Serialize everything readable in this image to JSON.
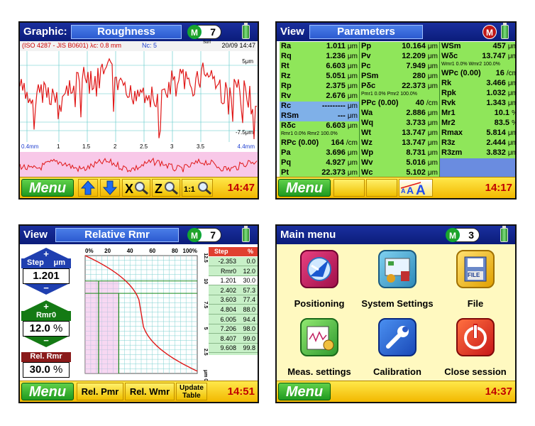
{
  "panel_graphic": {
    "label": "Graphic:",
    "title": "Roughness",
    "m_badge": "M",
    "count": "7",
    "info_left": "(ISO 4287 - JIS B0601)  λc: 0.8 mm",
    "info_nc": "Nc: 5",
    "surf": "Surf",
    "date": "20/09 14:47",
    "y_top": "5μm",
    "y_bottom": "-7.5μm",
    "x_left": "0.4mm",
    "x_ticks": [
      "1",
      "1.5",
      "2",
      "2.5",
      "3",
      "3.5"
    ],
    "x_right": "4.4mm",
    "menu": "Menu",
    "buttons": [
      "X",
      "Z",
      "1:1"
    ],
    "time": "14:47"
  },
  "panel_params": {
    "label": "View",
    "title": "Parameters",
    "m_badge": "M",
    "col1": [
      {
        "n": "Ra",
        "v": "1.011",
        "u": "μm"
      },
      {
        "n": "Rq",
        "v": "1.236",
        "u": "μm"
      },
      {
        "n": "Rt",
        "v": "6.603",
        "u": "μm"
      },
      {
        "n": "Rz",
        "v": "5.051",
        "u": "μm"
      },
      {
        "n": "Rp",
        "v": "2.375",
        "u": "μm"
      },
      {
        "n": "Rv",
        "v": "2.676",
        "u": "μm"
      },
      {
        "n": "Rc",
        "v": "---------",
        "u": "μm"
      },
      {
        "n": "RSm",
        "v": "---",
        "u": "μm"
      },
      {
        "n": "Rδc",
        "v": "6.603",
        "u": "μm"
      },
      {
        "n": "RPc (0.00)",
        "v": "164",
        "u": "/cm"
      },
      {
        "n": "Pa",
        "v": "3.696",
        "u": "μm"
      },
      {
        "n": "Pq",
        "v": "4.927",
        "u": "μm"
      },
      {
        "n": "Pt",
        "v": "22.373",
        "u": "μm"
      }
    ],
    "col1_sub": "Rmr1 0.0%  Rmr2 100.0%",
    "col2": [
      {
        "n": "Pp",
        "v": "10.164",
        "u": "μm"
      },
      {
        "n": "Pv",
        "v": "12.209",
        "u": "μm"
      },
      {
        "n": "Pc",
        "v": "7.949",
        "u": "μm"
      },
      {
        "n": "PSm",
        "v": "280",
        "u": "μm"
      },
      {
        "n": "Pδc",
        "v": "22.373",
        "u": "μm"
      },
      {
        "n": "PPc (0.00)",
        "v": "40",
        "u": "/cm"
      },
      {
        "n": "Wa",
        "v": "2.886",
        "u": "μm"
      },
      {
        "n": "Wq",
        "v": "3.733",
        "u": "μm"
      },
      {
        "n": "Wt",
        "v": "13.747",
        "u": "μm"
      },
      {
        "n": "Wz",
        "v": "13.747",
        "u": "μm"
      },
      {
        "n": "Wp",
        "v": "8.731",
        "u": "μm"
      },
      {
        "n": "Wv",
        "v": "5.016",
        "u": "μm"
      },
      {
        "n": "Wc",
        "v": "5.102",
        "u": "μm"
      }
    ],
    "col2_sub": "Pmr1 0.0%  Pmr2 100.0%",
    "col3": [
      {
        "n": "WSm",
        "v": "457",
        "u": "μm"
      },
      {
        "n": "Wδc",
        "v": "13.747",
        "u": "μm"
      },
      {
        "n": "WPc (0.00)",
        "v": "16",
        "u": "/cm"
      },
      {
        "n": "Rk",
        "v": "3.466",
        "u": "μm"
      },
      {
        "n": "Rpk",
        "v": "1.032",
        "u": "μm"
      },
      {
        "n": "Rvk",
        "v": "1.343",
        "u": "μm"
      },
      {
        "n": "Mr1",
        "v": "10.1",
        "u": "%"
      },
      {
        "n": "Mr2",
        "v": "83.5",
        "u": "%"
      },
      {
        "n": "Rmax",
        "v": "5.814",
        "u": "μm"
      },
      {
        "n": "R3z",
        "v": "2.444",
        "u": "μm"
      },
      {
        "n": "R3zm",
        "v": "3.832",
        "u": "μm"
      }
    ],
    "col3_sub": "Wmr1 0.0%  Wmr2 100.0%",
    "menu": "Menu",
    "time": "14:17"
  },
  "panel_rmr": {
    "label": "View",
    "title": "Relative Rmr",
    "m_badge": "M",
    "count": "7",
    "step_label": "Step",
    "step_unit": "μm",
    "step_value": "1.201",
    "rmr0_label": "Rmr0",
    "rmr0_value": "12.0",
    "rmr0_unit": "%",
    "rel_label": "Rel. Rmr",
    "rel_value": "30.0",
    "rel_unit": "%",
    "x_ticks": [
      "0%",
      "20",
      "40",
      "60",
      "80",
      "100%"
    ],
    "y_ticks": [
      "12.5",
      "10",
      "7.5",
      "5",
      "2.5",
      "μm 0"
    ],
    "table_headers": [
      "Step",
      "%"
    ],
    "table_rows": [
      [
        "-2.353",
        "0.0"
      ],
      [
        "Rmr0",
        "12.0"
      ],
      [
        "1.201",
        "30.0"
      ],
      [
        "2.402",
        "57.3"
      ],
      [
        "3.603",
        "77.4"
      ],
      [
        "4.804",
        "88.0"
      ],
      [
        "6.005",
        "94.4"
      ],
      [
        "7.206",
        "98.0"
      ],
      [
        "8.407",
        "99.0"
      ],
      [
        "9.608",
        "99.8"
      ]
    ],
    "menu": "Menu",
    "btn_pmr": "Rel. Pmr",
    "btn_wmr": "Rel. Wmr",
    "btn_update1": "Update",
    "btn_update2": "Table",
    "time": "14:51"
  },
  "panel_main": {
    "title": "Main menu",
    "m_badge": "M",
    "count": "3",
    "items": [
      {
        "label": "Positioning"
      },
      {
        "label": "System Settings"
      },
      {
        "label": "File",
        "icon_text": "FILE"
      },
      {
        "label": "Meas. settings"
      },
      {
        "label": "Calibration"
      },
      {
        "label": "Close session"
      }
    ],
    "menu": "Menu",
    "time": "14:37"
  },
  "colors": {
    "header_blue": "#0b1c7a",
    "footer_yellow": "#f2b800",
    "menu_green": "#1f9a1f",
    "param_green": "#8fe65a",
    "clock_red": "#c00000"
  }
}
